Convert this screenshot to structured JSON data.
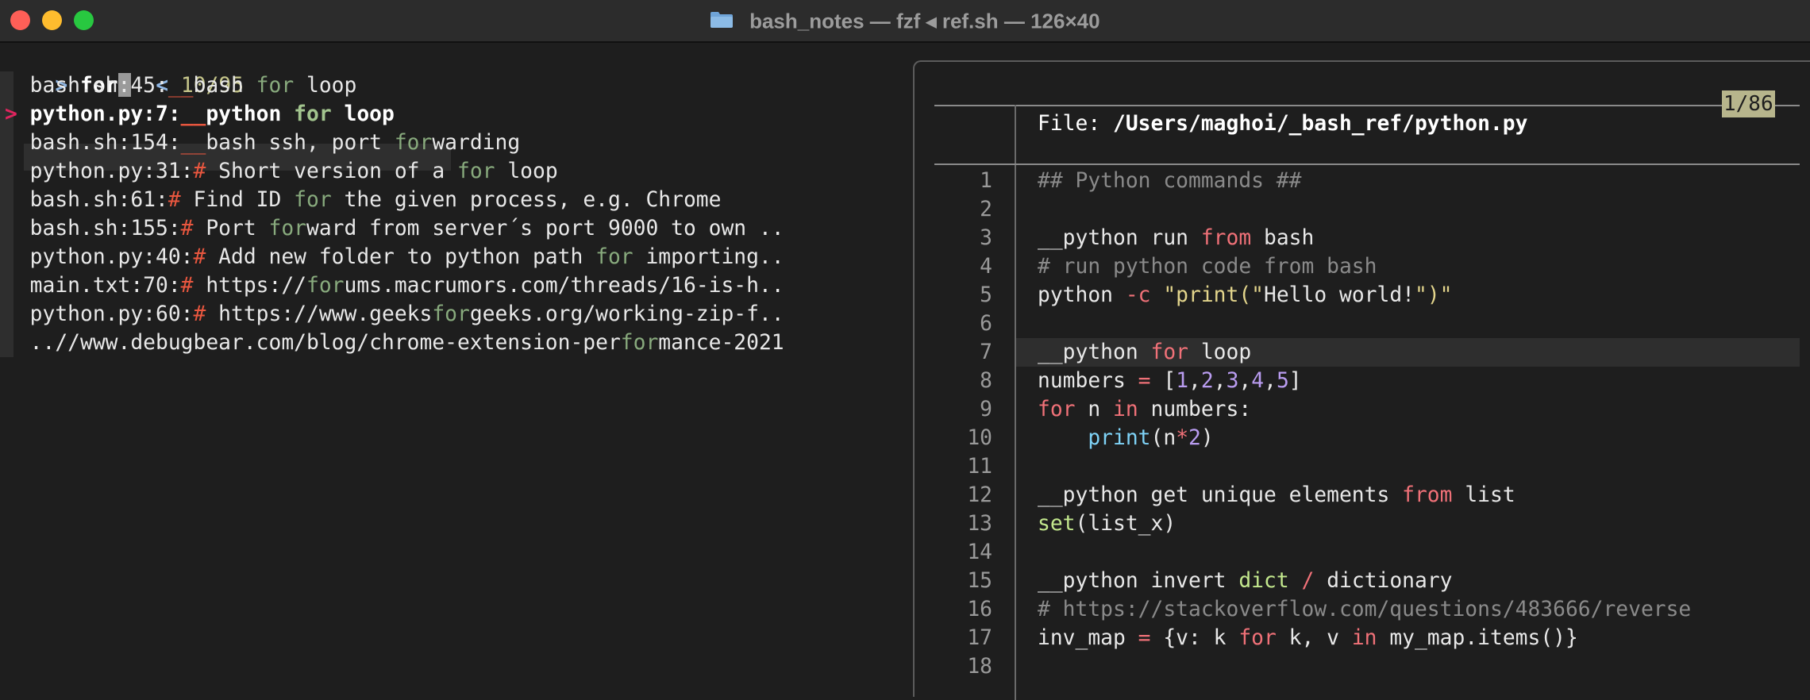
{
  "window": {
    "title": "bash_notes — fzf ◂ ref.sh — 126×40",
    "folder_icon": "folder-icon"
  },
  "prompt": {
    "marker": ">",
    "query": "for",
    "separator": "<",
    "counter": "10/95"
  },
  "results": [
    {
      "prefix": "bash.sh:45:",
      "parts": [
        [
          "ul",
          "__"
        ],
        [
          "t",
          "bash "
        ],
        [
          "m",
          "for"
        ],
        [
          "t",
          " loop"
        ]
      ]
    },
    {
      "prefix": "python.py:7:",
      "selected": true,
      "parts": [
        [
          "ul",
          "__"
        ],
        [
          "t",
          "python "
        ],
        [
          "m",
          "for"
        ],
        [
          "t",
          " loop"
        ]
      ]
    },
    {
      "prefix": "bash.sh:154:",
      "parts": [
        [
          "ul",
          "__"
        ],
        [
          "t",
          "bash ssh, port "
        ],
        [
          "m",
          "for"
        ],
        [
          "t",
          "warding"
        ]
      ]
    },
    {
      "prefix": "python.py:31:",
      "parts": [
        [
          "h",
          "#"
        ],
        [
          "t",
          " Short version of a "
        ],
        [
          "m",
          "for"
        ],
        [
          "t",
          " loop"
        ]
      ]
    },
    {
      "prefix": "bash.sh:61:",
      "parts": [
        [
          "h",
          "#"
        ],
        [
          "t",
          " Find ID "
        ],
        [
          "m",
          "for"
        ],
        [
          "t",
          " the given process, e.g. Chrome"
        ]
      ]
    },
    {
      "prefix": "bash.sh:155:",
      "parts": [
        [
          "h",
          "#"
        ],
        [
          "t",
          " Port "
        ],
        [
          "m",
          "for"
        ],
        [
          "t",
          "ward from server´s port 9000 to own .."
        ]
      ]
    },
    {
      "prefix": "python.py:40:",
      "parts": [
        [
          "h",
          "#"
        ],
        [
          "t",
          " Add new folder to python path "
        ],
        [
          "m",
          "for"
        ],
        [
          "t",
          " importing.."
        ]
      ]
    },
    {
      "prefix": "main.txt:70:",
      "parts": [
        [
          "h",
          "#"
        ],
        [
          "t",
          " https://"
        ],
        [
          "m",
          "for"
        ],
        [
          "t",
          "ums.macrumors.com/threads/16-is-h.."
        ]
      ]
    },
    {
      "prefix": "python.py:60:",
      "parts": [
        [
          "h",
          "#"
        ],
        [
          "t",
          " https://www.geeks"
        ],
        [
          "m",
          "for"
        ],
        [
          "t",
          "geeks.org/working-zip-f.."
        ]
      ]
    },
    {
      "prefix": "",
      "parts": [
        [
          "t",
          "..//www.debugbear.com/blog/chrome-extension-per"
        ],
        [
          "m",
          "for"
        ],
        [
          "t",
          "mance-2021"
        ]
      ]
    }
  ],
  "preview": {
    "page": "1/86",
    "file_label": "File: ",
    "file_path": "/Users/maghoi/_bash_ref/python.py",
    "lines": [
      {
        "n": "1",
        "parts": [
          [
            "c",
            "## Python commands ##"
          ]
        ]
      },
      {
        "n": "2",
        "parts": []
      },
      {
        "n": "3",
        "parts": [
          [
            "t",
            "__python run "
          ],
          [
            "k",
            "from"
          ],
          [
            "t",
            " bash"
          ]
        ]
      },
      {
        "n": "4",
        "parts": [
          [
            "c",
            "# run python code from bash"
          ]
        ]
      },
      {
        "n": "5",
        "parts": [
          [
            "t",
            "python "
          ],
          [
            "k",
            "-c"
          ],
          [
            "t",
            " "
          ],
          [
            "s",
            "\"print(\""
          ],
          [
            "t",
            "Hello world!"
          ],
          [
            "s",
            "\")\""
          ]
        ]
      },
      {
        "n": "6",
        "parts": []
      },
      {
        "n": "7",
        "highlight": true,
        "parts": [
          [
            "t",
            "__python "
          ],
          [
            "k",
            "for"
          ],
          [
            "t",
            " loop"
          ]
        ]
      },
      {
        "n": "8",
        "parts": [
          [
            "t",
            "numbers "
          ],
          [
            "k",
            "="
          ],
          [
            "t",
            " ["
          ],
          [
            "n",
            "1"
          ],
          [
            "t",
            ","
          ],
          [
            "n",
            "2"
          ],
          [
            "t",
            ","
          ],
          [
            "n",
            "3"
          ],
          [
            "t",
            ","
          ],
          [
            "n",
            "4"
          ],
          [
            "t",
            ","
          ],
          [
            "n",
            "5"
          ],
          [
            "t",
            "]"
          ]
        ]
      },
      {
        "n": "9",
        "parts": [
          [
            "k",
            "for"
          ],
          [
            "t",
            " n "
          ],
          [
            "k",
            "in"
          ],
          [
            "t",
            " numbers:"
          ]
        ]
      },
      {
        "n": "10",
        "parts": [
          [
            "t",
            "    "
          ],
          [
            "f",
            "print"
          ],
          [
            "t",
            "(n"
          ],
          [
            "k",
            "*"
          ],
          [
            "n",
            "2"
          ],
          [
            "t",
            ")"
          ]
        ]
      },
      {
        "n": "11",
        "parts": []
      },
      {
        "n": "12",
        "parts": [
          [
            "t",
            "__python get unique elements "
          ],
          [
            "k",
            "from"
          ],
          [
            "t",
            " list"
          ]
        ]
      },
      {
        "n": "13",
        "parts": [
          [
            "b",
            "set"
          ],
          [
            "t",
            "(list_x)"
          ]
        ]
      },
      {
        "n": "14",
        "parts": []
      },
      {
        "n": "15",
        "parts": [
          [
            "t",
            "__python invert "
          ],
          [
            "b",
            "dict"
          ],
          [
            "t",
            " "
          ],
          [
            "k",
            "/"
          ],
          [
            "t",
            " dictionary"
          ]
        ]
      },
      {
        "n": "16",
        "parts": [
          [
            "c",
            "# https://stackoverflow.com/questions/483666/reverse"
          ]
        ]
      },
      {
        "n": "17",
        "parts": [
          [
            "t",
            "inv_map "
          ],
          [
            "k",
            "="
          ],
          [
            "t",
            " {v: k "
          ],
          [
            "k",
            "for"
          ],
          [
            "t",
            " k, v "
          ],
          [
            "k",
            "in"
          ],
          [
            "t",
            " my_map.items()}"
          ]
        ]
      },
      {
        "n": "18",
        "parts": []
      }
    ]
  },
  "colors": {
    "background": "#1e1e1e",
    "match": "#88aa7d",
    "hash": "#e9573f",
    "keyword": "#f07178",
    "selected_marker": "#e0245e",
    "page_badge": "#b7b58c"
  }
}
